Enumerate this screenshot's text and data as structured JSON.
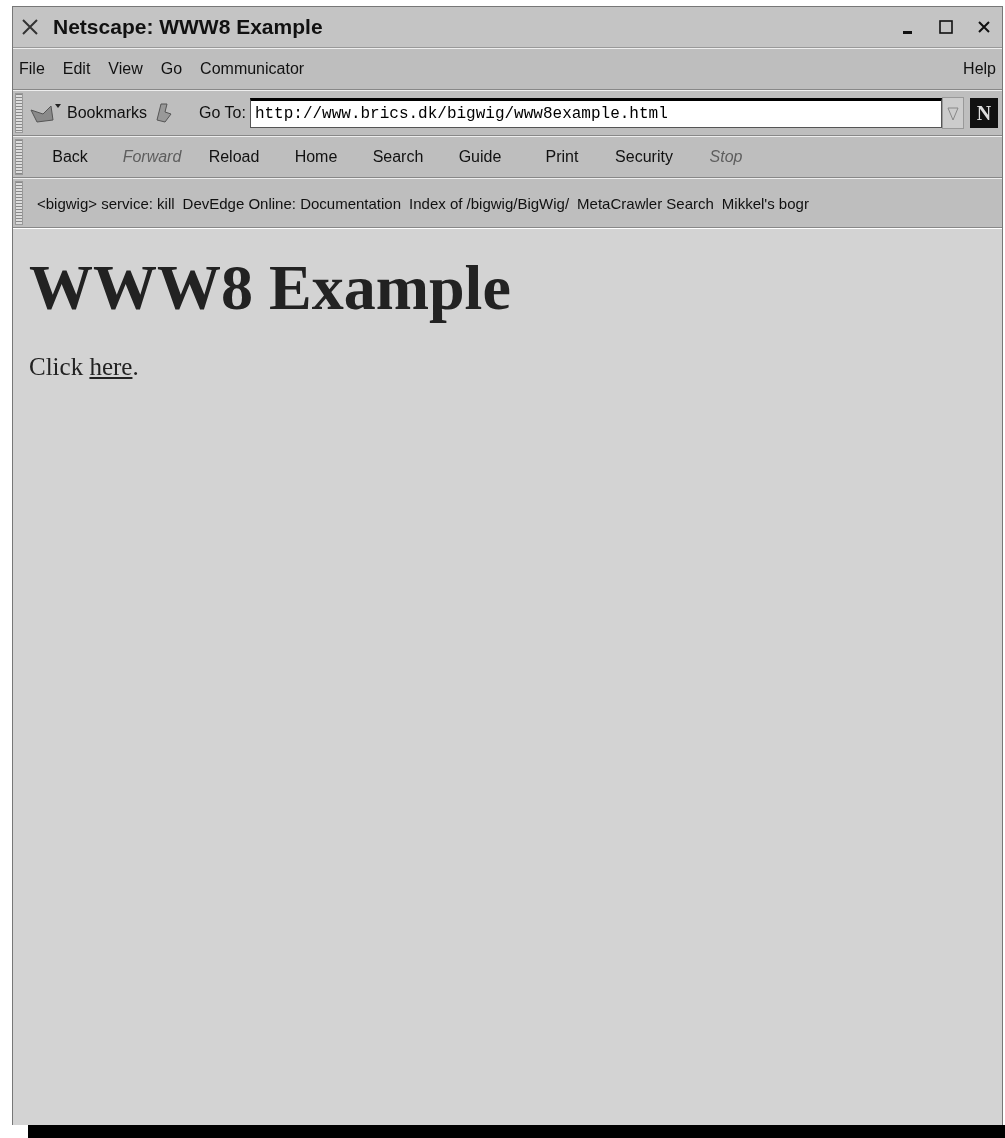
{
  "window": {
    "title": "Netscape: WWW8 Example"
  },
  "menu": [
    {
      "label": "File"
    },
    {
      "label": "Edit"
    },
    {
      "label": "View"
    },
    {
      "label": "Go"
    },
    {
      "label": "Communicator"
    }
  ],
  "menu_right": {
    "label": "Help"
  },
  "location_bar": {
    "bookmarks_label": "Bookmarks",
    "goto_label": "Go To:",
    "url": "http://www.brics.dk/bigwig/www8example.html",
    "logo_letter": "N"
  },
  "navigation": [
    {
      "label": "Back",
      "disabled": false
    },
    {
      "label": "Forward",
      "disabled": true
    },
    {
      "label": "Reload",
      "disabled": false
    },
    {
      "label": "Home",
      "disabled": false
    },
    {
      "label": "Search",
      "disabled": false
    },
    {
      "label": "Guide",
      "disabled": false
    },
    {
      "label": "Print",
      "disabled": false
    },
    {
      "label": "Security",
      "disabled": false
    },
    {
      "label": "Stop",
      "disabled": true
    }
  ],
  "personal_toolbar": [
    {
      "label": "<bigwig> service: kill"
    },
    {
      "label": "DevEdge Online: Documentation"
    },
    {
      "label": "Index of /bigwig/BigWig/"
    },
    {
      "label": "MetaCrawler Search"
    },
    {
      "label": "Mikkel's bogr"
    }
  ],
  "page": {
    "heading": "WWW8 Example",
    "text_before": "Click ",
    "link": "here",
    "text_after": "."
  }
}
